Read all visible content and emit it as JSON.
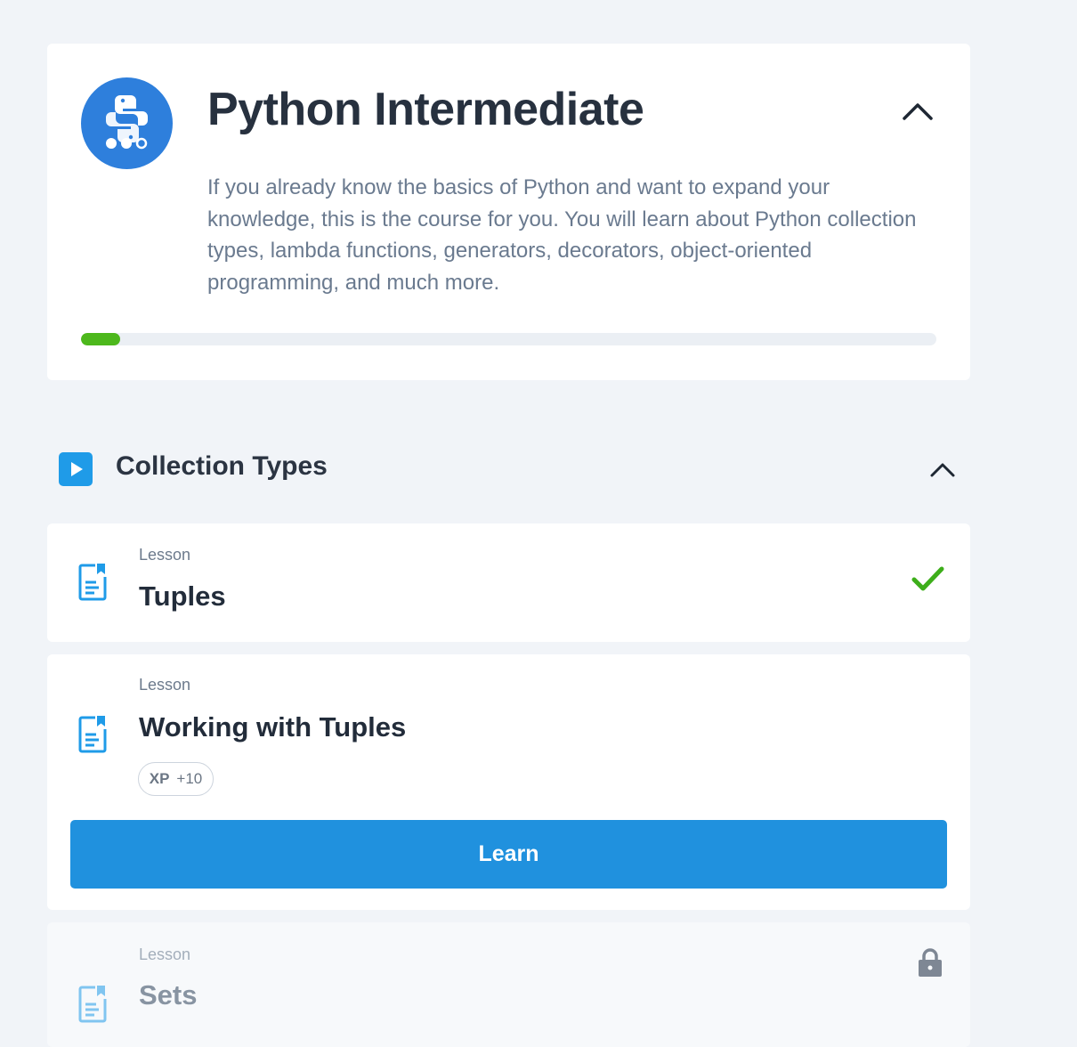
{
  "course": {
    "title": "Python Intermediate",
    "description": "If you already know the basics of Python and want to expand your knowledge, this is the course for you. You will learn about Python collection types, lambda functions, generators, decorators, object-oriented programming, and much more.",
    "progress": 0.046,
    "accent_color": "#2e7fdc",
    "progress_color": "#4db81c",
    "logo_icon": "python-logo-icon",
    "collapse_icon": "chevron-up-icon"
  },
  "module": {
    "title": "Collection Types",
    "icon": "play-icon",
    "collapse_icon": "chevron-up-icon"
  },
  "lessons": [
    {
      "kind": "Lesson",
      "title": "Tuples",
      "status": "completed",
      "status_icon": "checkmark-icon"
    },
    {
      "kind": "Lesson",
      "title": "Working with Tuples",
      "status": "current",
      "xp_label": "XP",
      "xp_value": "+10",
      "button_label": "Learn"
    },
    {
      "kind": "Lesson",
      "title": "Sets",
      "status": "locked",
      "status_icon": "lock-icon"
    }
  ]
}
